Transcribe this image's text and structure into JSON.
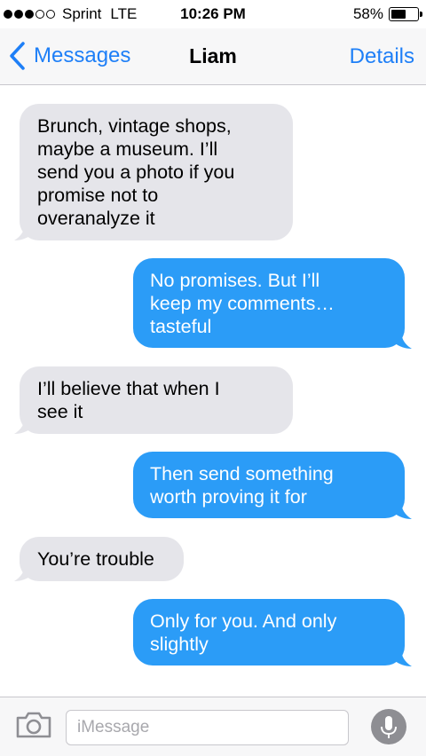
{
  "status": {
    "signal_bars_filled": 3,
    "signal_bars_total": 5,
    "carrier": "Sprint",
    "network": "LTE",
    "time": "10:26 PM",
    "battery_percent": "58%",
    "battery_level": 0.58
  },
  "nav": {
    "back_label": "Messages",
    "title": "Liam",
    "details_label": "Details",
    "accent_color": "#1e7ff7"
  },
  "messages": [
    {
      "from": "contact",
      "text": "Brunch, vintage shops,\nmaybe a museum. I’ll\nsend you a photo if you\npromise not to\noveranalyze it"
    },
    {
      "from": "me",
      "text": "No promises. But I’ll\nkeep my comments…\ntasteful"
    },
    {
      "from": "contact",
      "text": "I’ll believe that when I\nsee it"
    },
    {
      "from": "me",
      "text": "Then send something\nworth proving it for"
    },
    {
      "from": "contact",
      "text": "You’re trouble"
    },
    {
      "from": "me",
      "text": "Only for you. And only\nslightly"
    }
  ],
  "colors": {
    "incoming_bubble": "#e5e5ea",
    "outgoing_bubble": "#2b9cf7"
  },
  "input": {
    "placeholder": "iMessage",
    "value": "",
    "camera_icon": "camera-icon",
    "mic_icon": "microphone-icon"
  }
}
